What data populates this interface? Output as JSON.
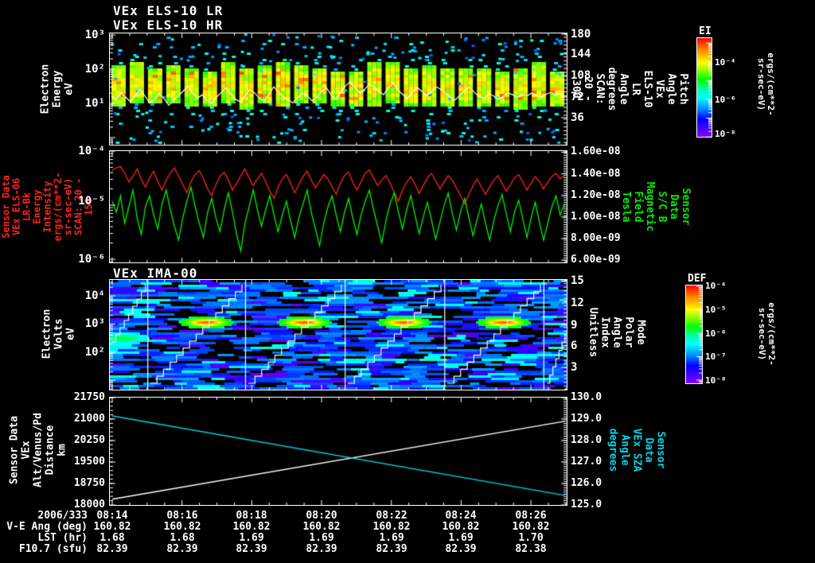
{
  "window": {
    "background": "#000000"
  },
  "colors": {
    "frame": "#ffffff",
    "els_intensity_red": "#ff2222",
    "magnetic_green": "#00ee00",
    "sza_cyan": "#00d4e8",
    "trace_white": "#ffffff"
  },
  "footer": {
    "date_label": "2006/333",
    "time_ticks": [
      "08:14",
      "08:16",
      "08:18",
      "08:20",
      "08:22",
      "08:24",
      "08:26"
    ],
    "rows": [
      {
        "label": "V-E Ang (deg)",
        "values": [
          "160.82",
          "160.82",
          "160.82",
          "160.82",
          "160.82",
          "160.82",
          "160.82"
        ]
      },
      {
        "label": "LST (hr)",
        "values": [
          "1.68",
          "1.68",
          "1.69",
          "1.69",
          "1.69",
          "1.69",
          "1.70"
        ]
      },
      {
        "label": "F10.7 (sfu)",
        "values": [
          "82.39",
          "82.39",
          "82.39",
          "82.39",
          "82.39",
          "82.39",
          "82.38"
        ]
      }
    ]
  },
  "chart_data": [
    {
      "id": "els_energy_spectrogram",
      "type": "heatmap",
      "title_lines": [
        "VEx ELS-10 LR",
        "VEx ELS-10 HR"
      ],
      "x_axis": {
        "start": "08:14",
        "end": "08:27",
        "major_ticks": [
          "08:14",
          "08:16",
          "08:18",
          "08:20",
          "08:22",
          "08:24",
          "08:26"
        ],
        "date": "2006/333"
      },
      "y_axis": {
        "label": "Electron Energy\neV",
        "scale": "log",
        "units": "eV",
        "ticks": [
          {
            "label": "10³",
            "f": 0.014
          },
          {
            "label": "10²",
            "f": 0.321
          },
          {
            "label": "10¹",
            "f": 0.629
          }
        ]
      },
      "right_axis": {
        "label": "Pitch Angle\nVEx ELS-10 LR\nAngle\ndegrees\nSCAN: 20 - 300",
        "range": [
          0,
          190
        ],
        "ticks": [
          {
            "label": "180",
            "f": 0.007
          },
          {
            "label": "144",
            "f": 0.186
          },
          {
            "label": "108",
            "f": 0.379
          },
          {
            "label": "72",
            "f": 0.571
          },
          {
            "label": "36",
            "f": 0.757
          }
        ]
      },
      "colorbar": {
        "title": "EI",
        "units": "ergs/(cm**2-sr-sec-eV)",
        "ticks": [
          {
            "label": "10⁻⁴",
            "f": 0.24
          },
          {
            "label": "10⁻⁶",
            "f": 0.62
          },
          {
            "label": "10⁻⁸",
            "f": 0.97
          }
        ]
      },
      "heatmap": {
        "columns": 25,
        "seed": 11,
        "style": "vertical-burst-columns",
        "core_log_ev": [
          0.9,
          2.1
        ],
        "scatter_dots": 300
      },
      "trace": {
        "name": "white overlay trace",
        "color": "#ffffff",
        "scale": "log10(eV)",
        "values": [
          1.2,
          1.12,
          1.3,
          1.18,
          1.05,
          1.25,
          1.4,
          1.22,
          1.02,
          1.12,
          1.28,
          1.15,
          0.95,
          1.08,
          1.22,
          1.35,
          1.5,
          1.3,
          1.15,
          1.25,
          1.1,
          1.0,
          1.18,
          1.32,
          1.45,
          1.28,
          1.12,
          1.05,
          1.22,
          1.4,
          1.3,
          1.15,
          1.08,
          1.26,
          1.48,
          1.32,
          1.2,
          1.1,
          1.02,
          1.16,
          1.3,
          1.22,
          1.08,
          1.18,
          1.35,
          1.45,
          1.25,
          1.12,
          1.32,
          1.5,
          1.62,
          1.45,
          1.3,
          1.4,
          1.55,
          1.48,
          1.35,
          1.25,
          1.45,
          1.58,
          1.38,
          1.26,
          1.15,
          1.3,
          1.46,
          1.35,
          1.22,
          1.32,
          1.48,
          1.4,
          1.28,
          1.18,
          1.1,
          1.24,
          1.38,
          1.46,
          1.32,
          1.2,
          1.14,
          1.28,
          1.22,
          1.12,
          1.2,
          1.3,
          1.25,
          1.18,
          1.26,
          1.22,
          1.3,
          1.24,
          1.18,
          1.26,
          1.32,
          1.24,
          1.28,
          1.2
        ]
      }
    },
    {
      "id": "els_intensity_and_magnetic_field",
      "type": "line",
      "y_axis": {
        "label": "Sensor Data\nVEx ELS-06 LR-Bk\nEnergy Intensity\nergs/(cm**2-sr-sec-eV)\nSCAN: 20 - 150",
        "color": "#ff2222",
        "scale": "log",
        "range_log10": [
          -4,
          -6
        ],
        "ticks": [
          {
            "label": "10⁻⁴",
            "f": 0.0
          },
          {
            "label": "10⁻⁵",
            "f": 0.45
          },
          {
            "label": "10⁻⁶",
            "f": 0.97
          }
        ]
      },
      "right_axis": {
        "label": "Sensor Data\nS/C B\nMagnetic Field\nTesla",
        "color": "#00ee00",
        "range": [
          1.6e-08,
          6e-09
        ],
        "ticks": [
          {
            "label": "1.60e-08",
            "f": 0.01
          },
          {
            "label": "1.40e-08",
            "f": 0.205
          },
          {
            "label": "1.20e-08",
            "f": 0.399
          },
          {
            "label": "1.00e-08",
            "f": 0.592
          },
          {
            "label": "8.00e-09",
            "f": 0.786
          },
          {
            "label": "6.00e-09",
            "f": 0.98
          }
        ]
      },
      "series": [
        {
          "name": "energy_intensity_log10",
          "color": "#ff2222",
          "axis": "left",
          "log_values": [
            -4.35,
            -4.3,
            -4.28,
            -4.4,
            -4.55,
            -4.45,
            -4.32,
            -4.5,
            -4.65,
            -4.48,
            -4.36,
            -4.55,
            -4.7,
            -4.52,
            -4.4,
            -4.3,
            -4.45,
            -4.6,
            -4.75,
            -4.55,
            -4.42,
            -4.35,
            -4.5,
            -4.68,
            -4.8,
            -4.6,
            -4.45,
            -4.38,
            -4.52,
            -4.7,
            -4.58,
            -4.44,
            -4.32,
            -4.48,
            -4.62,
            -4.5,
            -4.4,
            -4.55,
            -4.72,
            -4.85,
            -4.65,
            -4.5,
            -4.42,
            -4.58,
            -4.75,
            -4.6,
            -4.46,
            -4.36,
            -4.52,
            -4.66,
            -4.54,
            -4.42,
            -4.5,
            -4.64,
            -4.78,
            -4.58,
            -4.44,
            -4.38,
            -4.56,
            -4.7,
            -4.55,
            -4.4,
            -4.34,
            -4.48,
            -4.62,
            -4.52,
            -4.44,
            -4.58,
            -4.74,
            -4.9,
            -4.7,
            -4.56,
            -4.46,
            -4.6,
            -4.76,
            -4.62,
            -4.48,
            -4.4,
            -4.54,
            -4.68,
            -4.56,
            -4.44,
            -4.52,
            -4.66,
            -4.8,
            -4.95,
            -4.78,
            -4.62,
            -4.5,
            -4.64,
            -4.78,
            -4.64,
            -4.52,
            -4.44,
            -4.58,
            -4.72,
            -4.6,
            -4.48,
            -4.42,
            -4.56,
            -4.7,
            -4.58,
            -4.46,
            -4.54,
            -4.68,
            -4.56,
            -4.46,
            -4.4,
            -4.5,
            -4.44
          ]
        },
        {
          "name": "magnetic_field_log10",
          "color": "#00ee00",
          "axis": "left",
          "log_values": [
            -4.9,
            -5.1,
            -4.8,
            -5.3,
            -5.0,
            -4.7,
            -5.2,
            -5.5,
            -5.0,
            -4.8,
            -5.15,
            -5.4,
            -4.95,
            -4.7,
            -5.05,
            -5.35,
            -5.6,
            -5.2,
            -4.9,
            -4.65,
            -5.0,
            -5.3,
            -5.55,
            -5.1,
            -4.85,
            -5.2,
            -5.45,
            -5.05,
            -4.75,
            -5.1,
            -5.5,
            -5.8,
            -5.3,
            -5.0,
            -4.7,
            -5.05,
            -5.35,
            -5.05,
            -4.8,
            -5.15,
            -5.45,
            -5.15,
            -4.9,
            -5.25,
            -5.55,
            -5.2,
            -4.95,
            -4.7,
            -5.1,
            -5.4,
            -5.7,
            -5.3,
            -5.0,
            -4.8,
            -5.15,
            -5.45,
            -5.1,
            -4.85,
            -5.2,
            -5.5,
            -5.15,
            -4.9,
            -4.7,
            -5.05,
            -5.35,
            -5.65,
            -5.25,
            -4.95,
            -4.75,
            -5.1,
            -5.4,
            -5.05,
            -4.8,
            -5.15,
            -5.48,
            -5.18,
            -4.92,
            -5.25,
            -5.58,
            -5.28,
            -4.98,
            -4.75,
            -5.12,
            -5.42,
            -5.08,
            -4.85,
            -5.2,
            -5.52,
            -5.22,
            -4.95,
            -5.3,
            -5.6,
            -5.25,
            -4.98,
            -4.78,
            -5.12,
            -5.45,
            -5.1,
            -4.88,
            -5.22,
            -5.55,
            -5.2,
            -4.92,
            -5.28,
            -5.6,
            -5.3,
            -5.0,
            -4.8,
            -5.15,
            -4.95
          ]
        }
      ]
    },
    {
      "id": "ima_spectrogram",
      "type": "heatmap",
      "title": "VEx IMA-00",
      "y_axis": {
        "label": "Electron Volts\neV",
        "scale": "log",
        "ticks": [
          {
            "label": "10⁴",
            "f": 0.145
          },
          {
            "label": "10³",
            "f": 0.401
          },
          {
            "label": "10²",
            "f": 0.658
          }
        ]
      },
      "right_axis": {
        "label": "Mode\nPolar Angle\nIndex\nUnitless",
        "range": [
          0,
          15
        ],
        "ticks": [
          {
            "label": "15",
            "f": 0.01
          },
          {
            "label": "12",
            "f": 0.21
          },
          {
            "label": "9",
            "f": 0.41
          },
          {
            "label": "6",
            "f": 0.6
          },
          {
            "label": "3",
            "f": 0.8
          }
        ]
      },
      "colorbar": {
        "title": "DEF",
        "units": "ergs/(cm**2-sr-sec-eV)",
        "ticks": [
          {
            "label": "10⁻⁴",
            "f": 0.0
          },
          {
            "label": "10⁻⁵",
            "f": 0.24
          },
          {
            "label": "10⁻⁶",
            "f": 0.49
          },
          {
            "label": "10⁻⁷",
            "f": 0.72
          },
          {
            "label": "10⁻⁸",
            "f": 0.97
          }
        ]
      },
      "heatmap": {
        "seed": 7,
        "style": "horizontal-striped",
        "separators_x_f": [
          0.082,
          0.296,
          0.514,
          0.732,
          0.949
        ],
        "bright_blobs": {
          "log_ev": 3.0,
          "per_segment": true
        },
        "staircase": {
          "color": "#ffffff",
          "per_segment": true,
          "rises": "bottom-left to top-right"
        }
      }
    },
    {
      "id": "altitude_and_sza",
      "type": "line",
      "y_axis": {
        "label": "Sensor Data\nVEx Alt/Venus/Pd\nDistance\nkm",
        "range": [
          21750,
          18000
        ],
        "ticks": [
          {
            "label": "21750",
            "f": 0.0
          },
          {
            "label": "21000",
            "f": 0.2
          },
          {
            "label": "20250",
            "f": 0.4
          },
          {
            "label": "19500",
            "f": 0.6
          },
          {
            "label": "18750",
            "f": 0.8
          },
          {
            "label": "18000",
            "f": 1.0
          }
        ]
      },
      "right_axis": {
        "label": "Sensor Data\nVEx SZA\nAngle\ndegrees",
        "color": "#00d4e8",
        "range": [
          130.0,
          125.0
        ],
        "ticks": [
          {
            "label": "130.0",
            "f": 0.0
          },
          {
            "label": "129.0",
            "f": 0.2
          },
          {
            "label": "128.0",
            "f": 0.4
          },
          {
            "label": "127.0",
            "f": 0.6
          },
          {
            "label": "126.0",
            "f": 0.8
          },
          {
            "label": "125.0",
            "f": 1.0
          }
        ]
      },
      "series": [
        {
          "name": "altitude_km",
          "color": "#ffffff",
          "axis": "left",
          "points_f_value": [
            [
              0,
              18200
            ],
            [
              1,
              20920
            ]
          ]
        },
        {
          "name": "sza_degrees",
          "color": "#00d4e8",
          "axis": "right",
          "points_f_value": [
            [
              0,
              129.15
            ],
            [
              1,
              125.45
            ]
          ]
        }
      ]
    }
  ]
}
